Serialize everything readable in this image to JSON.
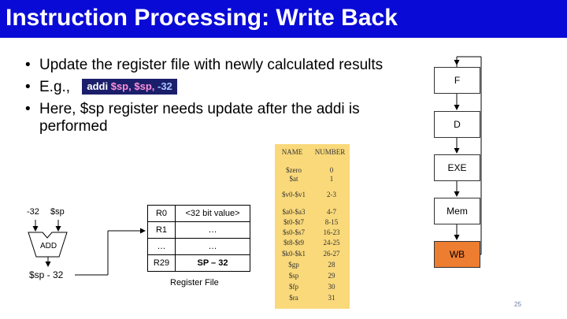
{
  "slide": {
    "title": "Instruction Processing: Write Back",
    "page_number": "25"
  },
  "bullets": [
    {
      "text": "Update the register file with newly calculated results"
    },
    {
      "text": "E.g.,"
    },
    {
      "text": "Here, $sp register needs update after the addi is performed"
    }
  ],
  "code": {
    "op": "addi",
    "arg1": "$sp,",
    "arg2": "$sp,",
    "imm": "-32"
  },
  "adder": {
    "input_a": "-32",
    "input_b": "$sp",
    "label": "ADD",
    "output": "$sp - 32"
  },
  "register_file": {
    "label": "Register File",
    "rows": [
      {
        "name": "R0",
        "value": "<32 bit value>"
      },
      {
        "name": "R1",
        "value": "…"
      },
      {
        "name": "…",
        "value": "…"
      },
      {
        "name": "R29",
        "value": "SP – 32"
      }
    ]
  },
  "register_names": {
    "header": [
      "NAME",
      "NUMBER"
    ],
    "rows": [
      {
        "name": "$zero",
        "number": "0"
      },
      {
        "name": "$at",
        "number": "1"
      },
      {
        "name": "$v0-$v1",
        "number": "2-3"
      },
      {
        "name": "$a0-$a3",
        "number": "4-7"
      },
      {
        "name": "$t0-$t7",
        "number": "8-15"
      },
      {
        "name": "$s0-$s7",
        "number": "16-23"
      },
      {
        "name": "$t8-$t9",
        "number": "24-25"
      },
      {
        "name": "$k0-$k1",
        "number": "26-27"
      },
      {
        "name": "$gp",
        "number": "28"
      },
      {
        "name": "$sp",
        "number": "29"
      },
      {
        "name": "$fp",
        "number": "30"
      },
      {
        "name": "$ra",
        "number": "31"
      }
    ]
  },
  "pipeline": {
    "stages": [
      "F",
      "D",
      "EXE",
      "Mem",
      "WB"
    ],
    "active_stage": "WB",
    "active_color": "#ed7d31"
  },
  "colors": {
    "title_bar": "#0a0ad6",
    "register_table": "#f9d97a"
  }
}
